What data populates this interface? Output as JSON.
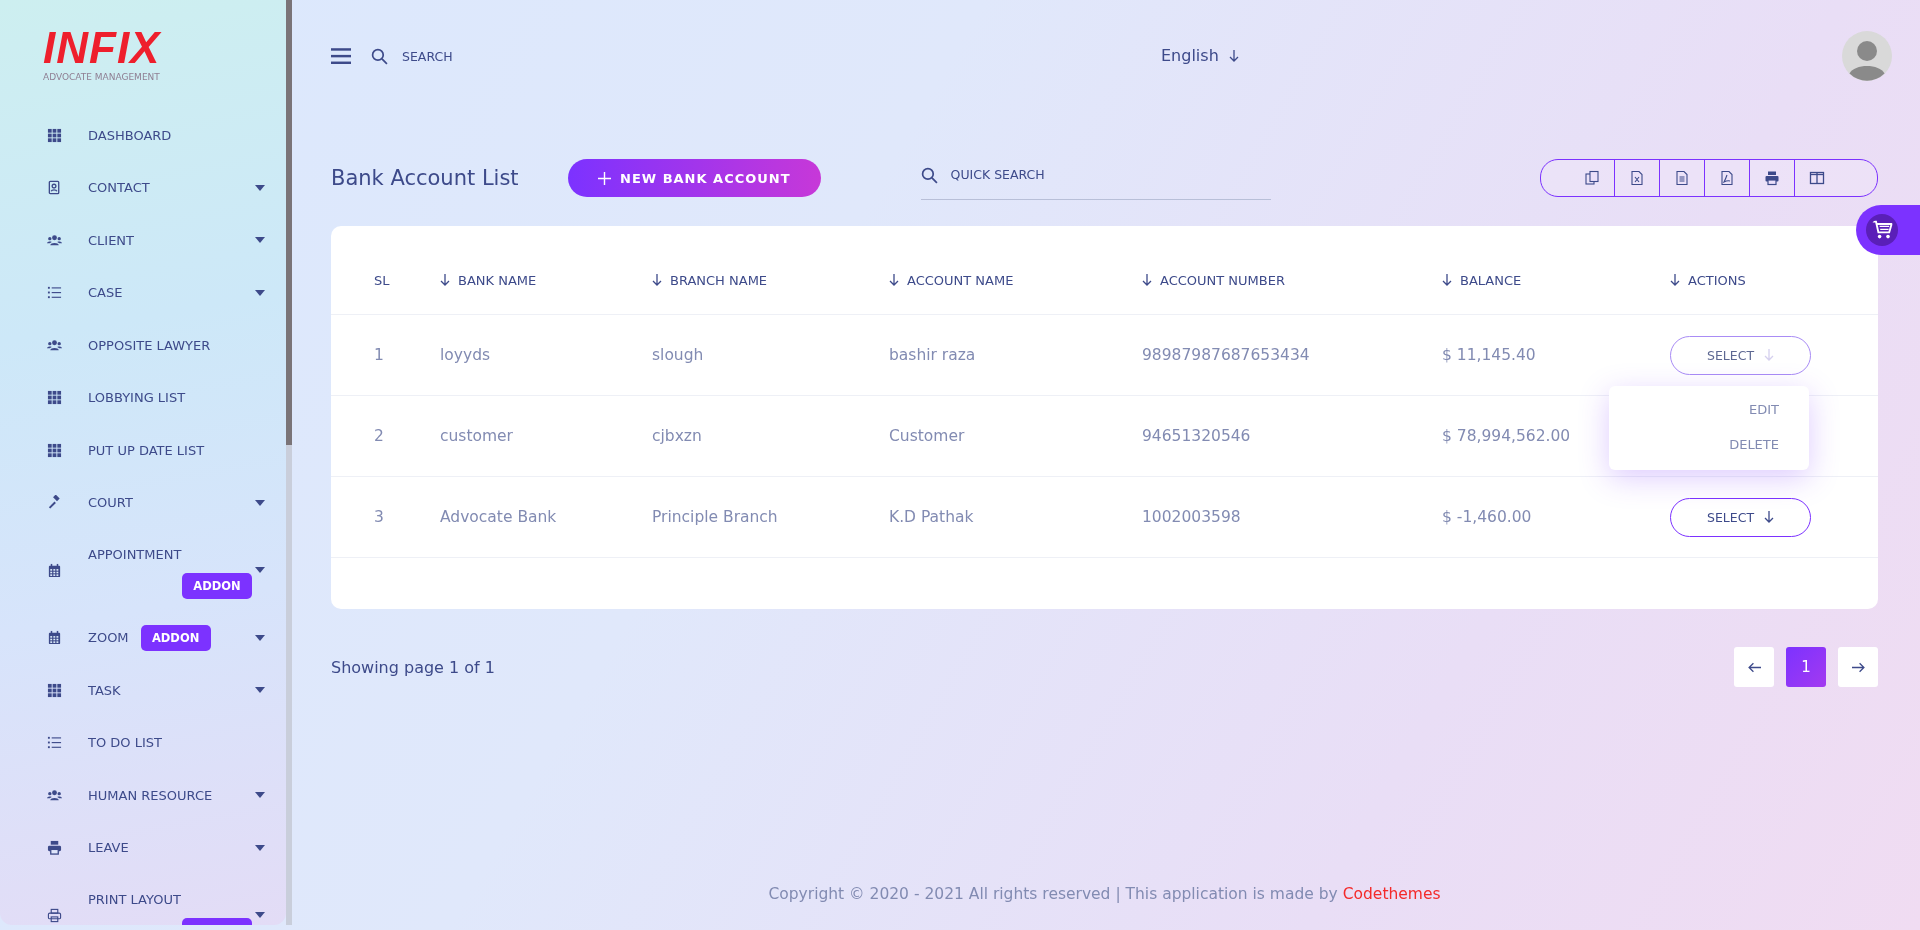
{
  "brand": {
    "logo": "INFIX",
    "tagline": "ADVOCATE MANAGEMENT"
  },
  "sidebar": {
    "items": [
      {
        "label": "DASHBOARD",
        "kind": "grid",
        "expandable": false
      },
      {
        "label": "CONTACT",
        "kind": "contact",
        "expandable": true
      },
      {
        "label": "CLIENT",
        "kind": "users",
        "expandable": true
      },
      {
        "label": "CASE",
        "kind": "list",
        "expandable": true
      },
      {
        "label": "OPPOSITE LAWYER",
        "kind": "users",
        "expandable": false
      },
      {
        "label": "LOBBYING LIST",
        "kind": "grid",
        "expandable": false
      },
      {
        "label": "PUT UP DATE LIST",
        "kind": "grid",
        "expandable": false
      },
      {
        "label": "COURT",
        "kind": "gavel",
        "expandable": true
      },
      {
        "label": "APPOINTMENT",
        "kind": "calendar",
        "expandable": true,
        "addon": "ADDON",
        "addon_below": true
      },
      {
        "label": "ZOOM",
        "kind": "calendar",
        "expandable": true,
        "addon": "ADDON",
        "addon_below": false
      },
      {
        "label": "TASK",
        "kind": "grid",
        "expandable": true
      },
      {
        "label": "TO DO LIST",
        "kind": "list",
        "expandable": false
      },
      {
        "label": "HUMAN RESOURCE",
        "kind": "users",
        "expandable": true
      },
      {
        "label": "LEAVE",
        "kind": "printer",
        "expandable": true
      },
      {
        "label": "PRINT LAYOUT",
        "kind": "printer-outline",
        "expandable": true,
        "addon_cut": true,
        "addon_below": true
      }
    ]
  },
  "topbar": {
    "search": {
      "placeholder": "SEARCH"
    },
    "language": "English"
  },
  "page": {
    "title": "Bank Account List",
    "new_button": "NEW BANK ACCOUNT",
    "quick_search": {
      "placeholder": "QUICK SEARCH"
    },
    "export_buttons": [
      {
        "kind": "copy"
      },
      {
        "kind": "excel"
      },
      {
        "kind": "csv"
      },
      {
        "kind": "pdf"
      },
      {
        "kind": "print"
      },
      {
        "kind": "columns"
      }
    ]
  },
  "table": {
    "columns": [
      {
        "label": "SL",
        "sortable": false
      },
      {
        "label": "BANK NAME",
        "sortable": true
      },
      {
        "label": "BRANCH NAME",
        "sortable": true
      },
      {
        "label": "ACCOUNT NAME",
        "sortable": true
      },
      {
        "label": "ACCOUNT NUMBER",
        "sortable": true
      },
      {
        "label": "BALANCE",
        "sortable": true
      },
      {
        "label": "ACTIONS",
        "sortable": true
      }
    ],
    "rows": [
      {
        "cells": [
          "1",
          "loyyds",
          "slough",
          "bashir raza",
          "98987987687653434",
          "$ 11,145.40"
        ],
        "action": {
          "label": "SELECT",
          "open": true,
          "menu": [
            "EDIT",
            "DELETE"
          ]
        }
      },
      {
        "cells": [
          "2",
          "customer",
          "cjbxzn",
          "Customer",
          "94651320546",
          "$ 78,994,562.00"
        ]
      },
      {
        "cells": [
          "3",
          "Advocate Bank",
          "Principle Branch",
          "K.D Pathak",
          "1002003598",
          "$ -1,460.00"
        ],
        "action": {
          "label": "SELECT",
          "open": false
        }
      }
    ]
  },
  "pagination": {
    "summary": "Showing page 1 of 1",
    "pages": [
      {
        "label": "1",
        "selected": true
      }
    ]
  },
  "footer": {
    "text": "Copyright © 2020 - 2021 All rights reserved | This application is made by ",
    "link": "Codethemes"
  }
}
